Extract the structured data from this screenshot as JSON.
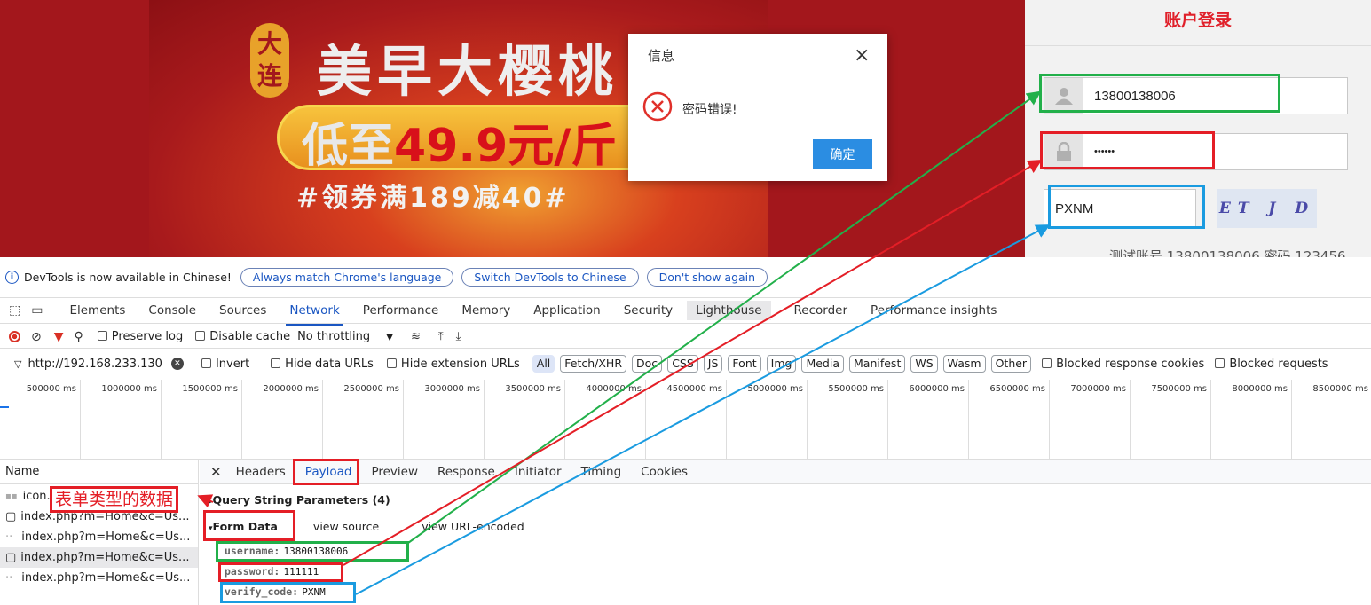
{
  "webpage": {
    "banner": {
      "badge": [
        "大",
        "连"
      ],
      "title": "美早大樱桃",
      "price_gray": "低至",
      "price_red": "49.9元/斤",
      "coupon": "#领券满189减40#"
    },
    "login": {
      "title": "账户登录",
      "username": "13800138006",
      "password_mask": "••••••",
      "captcha_input": "PXNM",
      "captcha_image": "ET J D",
      "test_account": "测试账号 13800138006 密码 123456"
    },
    "modal": {
      "title": "信息",
      "close": "×",
      "icon": "error-circle-icon",
      "message": "密码错误!",
      "ok": "确定"
    }
  },
  "devtools": {
    "infobar": {
      "message": "DevTools is now available in Chinese!",
      "btn_match": "Always match Chrome's language",
      "btn_switch": "Switch DevTools to Chinese",
      "btn_dismiss": "Don't show again"
    },
    "tabs": [
      "Elements",
      "Console",
      "Sources",
      "Network",
      "Performance",
      "Memory",
      "Application",
      "Security",
      "Lighthouse",
      "Recorder",
      "Performance insights"
    ],
    "active_tab": "Network",
    "toolbar": {
      "preserve_log": "Preserve log",
      "disable_cache": "Disable cache",
      "throttling": "No throttling"
    },
    "filter": {
      "value": "http://192.168.233.130",
      "invert": "Invert",
      "hide_data": "Hide data URLs",
      "hide_ext": "Hide extension URLs",
      "types": [
        "All",
        "Fetch/XHR",
        "Doc",
        "CSS",
        "JS",
        "Font",
        "Img",
        "Media",
        "Manifest",
        "WS",
        "Wasm",
        "Other"
      ],
      "blocked_cookies": "Blocked response cookies",
      "blocked_requests": "Blocked requests"
    },
    "timeline_ticks": [
      "500000 ms",
      "1000000 ms",
      "1500000 ms",
      "2000000 ms",
      "2500000 ms",
      "3000000 ms",
      "3500000 ms",
      "4000000 ms",
      "4500000 ms",
      "5000000 ms",
      "5500000 ms",
      "6000000 ms",
      "6500000 ms",
      "7000000 ms",
      "7500000 ms",
      "8000000 ms",
      "8500000 ms"
    ],
    "name_header": "Name",
    "requests": [
      "icon.png",
      "index.php?m=Home&c=Us...",
      "index.php?m=Home&c=Us...",
      "index.php?m=Home&c=Us...",
      "index.php?m=Home&c=Us..."
    ],
    "detail_tabs": [
      "Headers",
      "Payload",
      "Preview",
      "Response",
      "Initiator",
      "Timing",
      "Cookies"
    ],
    "active_detail_tab": "Payload",
    "payload": {
      "query_string": "Query String Parameters (4)",
      "form_data": "Form Data",
      "view_source": "view source",
      "view_url": "view URL-encoded",
      "fields": [
        {
          "key": "username:",
          "value": "13800138006"
        },
        {
          "key": "password:",
          "value": "111111"
        },
        {
          "key": "verify_code:",
          "value": "PXNM"
        }
      ]
    }
  },
  "annotation": {
    "label": "表单类型的数据",
    "colors": {
      "green": "#22b04a",
      "red": "#e41e26",
      "blue": "#1a9be0"
    }
  }
}
